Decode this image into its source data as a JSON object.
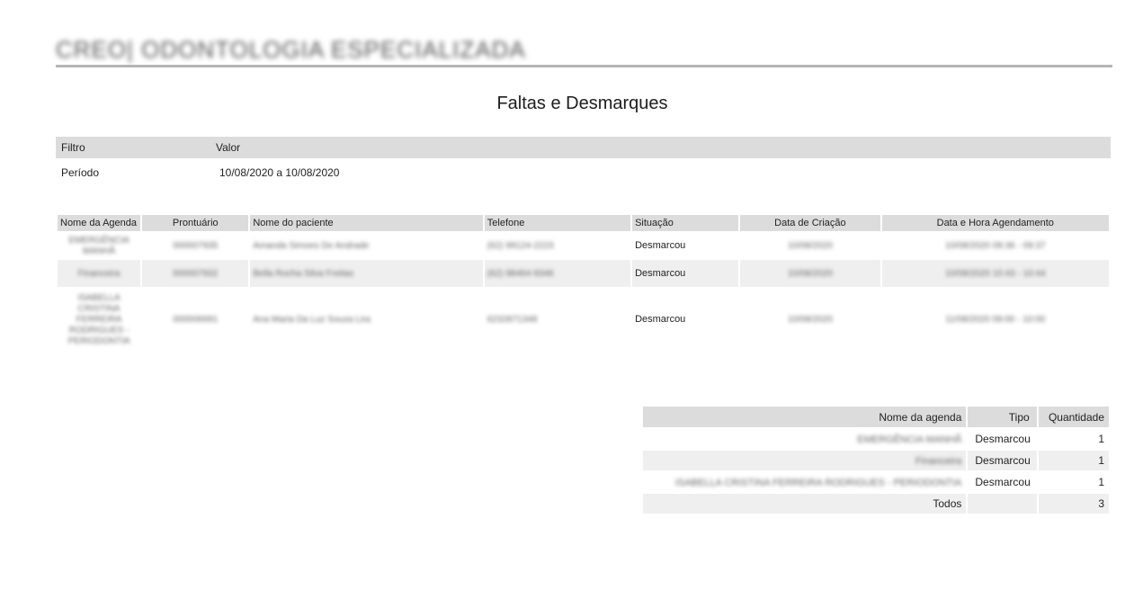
{
  "header": {
    "organization": "CREO| ODONTOLOGIA ESPECIALIZADA",
    "report_title": "Faltas e Desmarques"
  },
  "filters": {
    "headers": [
      "Filtro",
      "Valor"
    ],
    "rows": [
      {
        "name": "Período",
        "value": "10/08/2020 a 10/08/2020"
      }
    ]
  },
  "appointments": {
    "headers": [
      "Nome da Agenda",
      "Prontuário",
      "Nome do paciente",
      "Telefone",
      "Situação",
      "Data de Criação",
      "Data e Hora Agendamento"
    ],
    "rows": [
      {
        "agenda": "EMERGÊNCIA MANHÃ",
        "prontuario": "000007935",
        "paciente": "Amanda Simoes De Andrade",
        "telefone": "(62) 99124-2223",
        "situacao": "Desmarcou",
        "criacao": "10/08/2020",
        "agendamento": "10/08/2020 09:36 - 09:37"
      },
      {
        "agenda": "Financeira",
        "prontuario": "000007932",
        "paciente": "Bella Rocha Silva Freitas",
        "telefone": "(62) 98464-9346",
        "situacao": "Desmarcou",
        "criacao": "10/08/2020",
        "agendamento": "10/08/2020 10:43 - 10:44"
      },
      {
        "agenda": "ISABELLA CRISTINA FERREIRA RODRIGUES - PERIODONTIA",
        "prontuario": "000006691",
        "paciente": "Ana Maria Da Luz Souza Lira",
        "telefone": "6232871348",
        "situacao": "Desmarcou",
        "criacao": "10/08/2020",
        "agendamento": "11/08/2020 09:00 - 10:00"
      }
    ]
  },
  "summary": {
    "headers": [
      "Nome da agenda",
      "Tipo",
      "Quantidade"
    ],
    "rows": [
      {
        "agenda": "EMERGÊNCIA MANHÃ",
        "tipo": "Desmarcou",
        "quantidade": "1"
      },
      {
        "agenda": "Financeira",
        "tipo": "Desmarcou",
        "quantidade": "1"
      },
      {
        "agenda": "ISABELLA CRISTINA FERREIRA RODRIGUES - PERIODONTIA",
        "tipo": "Desmarcou",
        "quantidade": "1"
      }
    ],
    "total": {
      "label": "Todos",
      "tipo": "",
      "quantidade": "3"
    }
  }
}
